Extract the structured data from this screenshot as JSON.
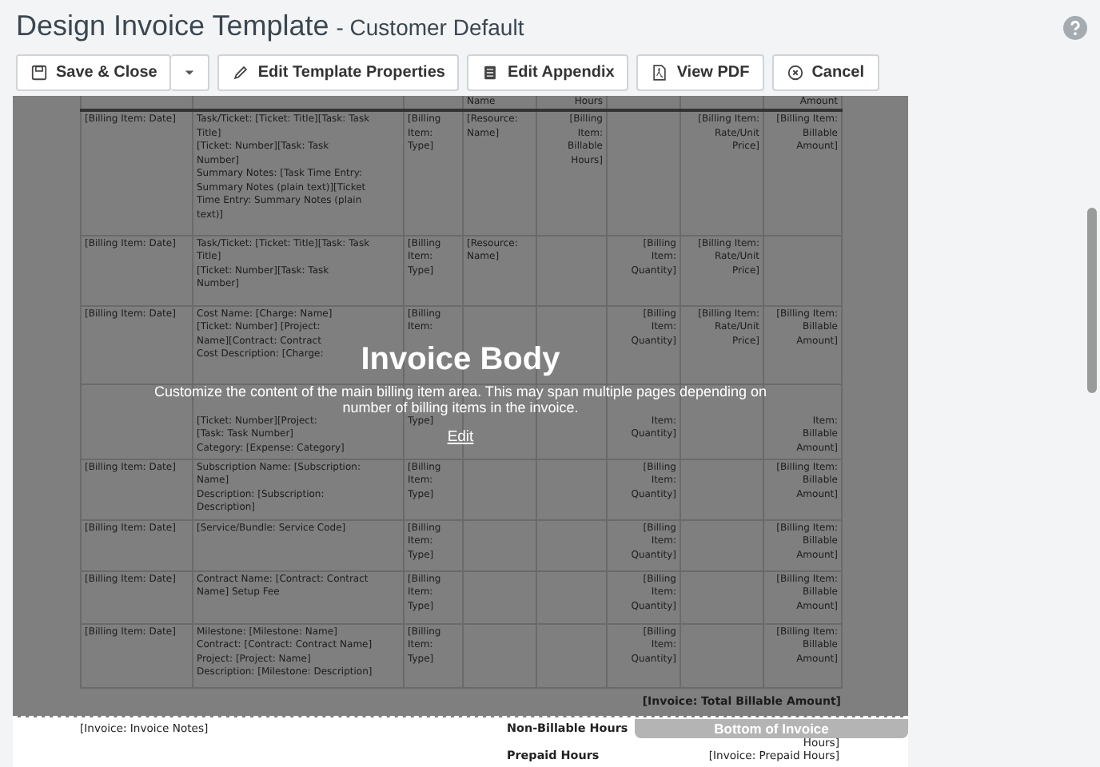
{
  "window": {
    "title": "Design Invoice Template",
    "subtitle": "- Customer Default"
  },
  "toolbar": [
    {
      "label": "Save & Close"
    },
    {
      "label": "Edit Template Properties"
    },
    {
      "label": "Edit Appendix"
    },
    {
      "label": "View PDF"
    },
    {
      "label": "Cancel"
    }
  ],
  "invoice_body": {
    "header_row": {
      "column_4": "Name",
      "column_5": "Hours",
      "column_8": "Amount"
    },
    "rows": [
      {
        "column_1": "[Billing Item: Date]",
        "column_2": "Task/Ticket: [Ticket: Title][Task: Task\nTitle]\n[Ticket: Number][Task: Task\nNumber]\nSummary Notes: [Task Time Entry:\nSummary Notes (plain text)][Ticket\nTime Entry: Summary Notes (plain\ntext)]",
        "column_3": "[Billing\nItem:\nType]",
        "column_4": "[Resource:\nName]",
        "column_5": "[Billing\nItem:\nBillable\nHours]",
        "column_7": "[Billing Item:\nRate/Unit\nPrice]",
        "column_8": "[Billing Item:\nBillable\nAmount]"
      },
      {
        "column_1": "[Billing Item: Date]",
        "column_2": "Task/Ticket: [Ticket: Title][Task: Task\nTitle]\n[Ticket: Number][Task: Task\nNumber]",
        "column_3": "[Billing\nItem:\nType]",
        "column_4": "[Resource:\nName]",
        "column_6": "[Billing\nItem:\nQuantity]",
        "column_7": "[Billing Item:\nRate/Unit\nPrice]"
      },
      {
        "column_1": "[Billing Item: Date]",
        "column_2": "Cost Name: [Charge: Name]\n[Ticket: Number] [Project:\nName][Contract: Contract\nCost Description: [Charge:",
        "column_3": "[Billing\nItem:",
        "column_6": "[Billing\nItem:\nQuantity]",
        "column_7": "[Billing Item:\nRate/Unit\nPrice]",
        "column_8": "[Billing Item:\nBillable\nAmount]"
      },
      {
        "column_2": "[Ticket: Number][Project:\n[Task: Task Number]\nCategory: [Expense: Category]",
        "column_3": "Type]",
        "column_6": "Item:\nQuantity]",
        "column_8": "Item:\nBillable\nAmount]"
      },
      {
        "column_1": "[Billing Item: Date]",
        "column_2": "Subscription Name: [Subscription:\nName]\nDescription: [Subscription:\nDescription]",
        "column_3": "[Billing\nItem:\nType]",
        "column_6": "[Billing\nItem:\nQuantity]",
        "column_8": "[Billing Item:\nBillable\nAmount]"
      },
      {
        "column_1": "[Billing Item: Date]",
        "column_2": "[Service/Bundle: Service Code]",
        "column_3": "[Billing\nItem:\nType]",
        "column_6": "[Billing\nItem:\nQuantity]",
        "column_8": "[Billing Item:\nBillable\nAmount]"
      },
      {
        "column_1": "[Billing Item: Date]",
        "column_2": "Contract Name: [Contract: Contract\nName] Setup Fee",
        "column_3": "[Billing\nItem:\nType]",
        "column_6": "[Billing\nItem:\nQuantity]",
        "column_8": "[Billing Item:\nBillable\nAmount]"
      },
      {
        "column_1": "[Billing Item: Date]",
        "column_2": "Milestone: [Milestone: Name]\nContract: [Contract: Contract Name]\nProject: [Project: Name]\nDescription: [Milestone: Description]",
        "column_3": "[Billing\nItem:\nType]",
        "column_6": "[Billing\nItem:\nQuantity]",
        "column_8": "[Billing Item:\nBillable\nAmount]"
      }
    ],
    "total": "[Invoice: Total Billable Amount]",
    "overlay": {
      "title": "Invoice Body",
      "description": "Customize the content of the main billing item area. This may span multiple pages depending on number of billing items in the invoice.",
      "link": "Edit"
    }
  },
  "bottom_section": {
    "notes": "[Invoice: Invoice Notes]",
    "summary": [
      {
        "label": "Non-Billable Hours",
        "value": "Hours]"
      },
      {
        "label": "Prepaid Hours",
        "value": "[Invoice: Prepaid Hours]"
      }
    ],
    "overlay_label": "Bottom of Invoice"
  }
}
